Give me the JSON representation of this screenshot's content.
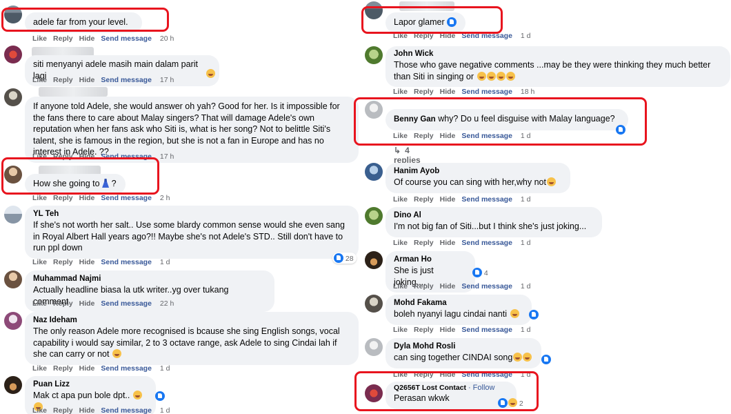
{
  "actions": {
    "like": "Like",
    "reply": "Reply",
    "hide": "Hide",
    "send": "Send message"
  },
  "left_comments": [
    {
      "author": "",
      "text": "adele far from your level.",
      "time": "20 h"
    },
    {
      "author": "",
      "text": "siti menyanyi adele masih main dalam parit lagi",
      "time": "17 h"
    },
    {
      "author": "",
      "text": "If anyone told Adele, she would answer oh yah? Good for her. Is it impossible for the fans there to care about Malay singers? That will damage Adele's own reputation when her fans ask who Siti is, what is her song? Not to belittle Siti's talent, she is famous in the region, but she is not a fan in Europe and has no interest in Adele. ??",
      "time": "17 h"
    },
    {
      "author": "",
      "text": "How she going to",
      "text_after": "?",
      "time": "2 h"
    },
    {
      "author": "YL Teh",
      "text": "If she's not worth her salt.. Use some blardy common sense would she even sang in Royal Albert Hall years ago?!! Maybe she's not Adele's STD.. Still don't have to run ppl down",
      "time": "1 d",
      "reactions": "28"
    },
    {
      "author": "Muhammad Najmi",
      "text": "Actually headline biasa la utk writer..yg over tukang comment",
      "time": "22 h"
    },
    {
      "author": "Naz Ideham",
      "text": "The only reason Adele more recognised is bcause she sing English songs, vocal capability i would say similar, 2 to 3 octave range, ask Adele to sing Cindai lah if she can carry or not",
      "time": "1 d"
    },
    {
      "author": "Puan Lizz",
      "text": "Mak ct apa pun bole dpt..",
      "time": "1 d"
    }
  ],
  "right_comments": [
    {
      "author": "",
      "text": "Lapor glamer",
      "time": "1 d"
    },
    {
      "author": "John Wick",
      "text": "Those who gave negative comments ...may be they were thinking they much better than Siti in singing or",
      "time": "18 h"
    },
    {
      "author": "Benny Gan",
      "text": "why? Do u feel disguise with Malay language?",
      "time": "1 d",
      "replies": "4 replies"
    },
    {
      "author": "Hanim Ayob",
      "text": "Of course you can sing with her,why not",
      "time": "1 d"
    },
    {
      "author": "Dino Al",
      "text": "I'm not big fan of Siti...but I think she's just joking...",
      "time": "1 d"
    },
    {
      "author": "Arman Ho",
      "text": "She is just joking....",
      "time": "1 d",
      "reactions": "4"
    },
    {
      "author": "Mohd Fakama",
      "text": "boleh nyanyi lagu cindai nanti",
      "time": "1 d"
    },
    {
      "author": "Dyla Mohd Rosli",
      "text": "can sing together CINDAI song",
      "time": "1 d"
    },
    {
      "author": "Q2656T Lost Contact",
      "follow": "· Follow",
      "text": "Perasan wkwk",
      "time": "1 d",
      "reactions": "2"
    }
  ],
  "colors": {
    "highlight": "#e8141e",
    "link": "#385898",
    "bubble": "#f0f2f5",
    "meta": "#65676b"
  },
  "icons": [
    "like-reaction-icon",
    "haha-reaction-icon",
    "dress-emoji-icon",
    "reply-arrow-icon"
  ]
}
